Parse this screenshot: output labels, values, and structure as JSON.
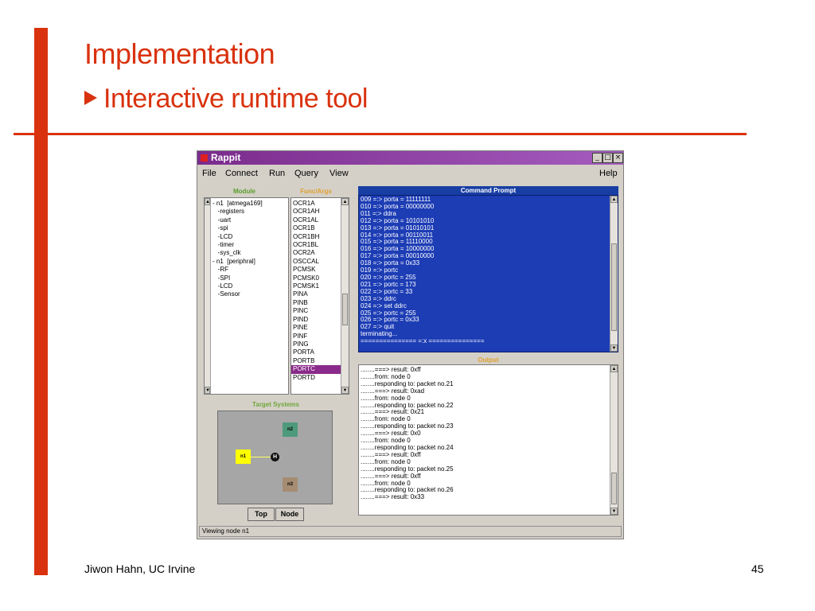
{
  "slide": {
    "title": "Implementation",
    "subtitle": "Interactive runtime tool",
    "footer_author": "Jiwon Hahn, UC Irvine",
    "page_number": "45",
    "accent_color": "#d9320e"
  },
  "app": {
    "title": "Rappit",
    "menu": [
      "File",
      "Connect",
      "Run",
      "Query",
      "View"
    ],
    "help": "Help",
    "module_label": "Module",
    "func_label": "Func/Args",
    "modules": [
      "- n1  [atmega169]",
      "   -registers",
      "   -uart",
      "   -spi",
      "   -LCD",
      "   -timer",
      "   -sys_clk",
      "- n1  [periphral]",
      "   -RF",
      "   -SPI",
      "   -LCD",
      "   -Sensor"
    ],
    "funcs": [
      "OCR1A",
      "OCR1AH",
      "OCR1AL",
      "OCR1B",
      "OCR1BH",
      "OCR1BL",
      "OCR2A",
      "OSCCAL",
      "PCMSK",
      "PCMSK0",
      "PCMSK1",
      "PINA",
      "PINB",
      "PINC",
      "PIND",
      "PINE",
      "PINF",
      "PING",
      "PORTA",
      "PORTB",
      "PORTC",
      "PORTD"
    ],
    "selected_func": "PORTC",
    "command_prompt_label": "Command Prompt",
    "command_lines": [
      "009 =:> porta = 11111111",
      "010 =:> porta = 00000000",
      "011 =:> ddra",
      "012 =:> porta = 10101010",
      "013 =:> porta = 01010101",
      "014 =:> porta = 00110011",
      "015 =:> porta = 11110000",
      "016 =:> porta = 10000000",
      "017 =:> porta = 00010000",
      "018 =:> porta = 0x33",
      "019 =:> portc",
      "020 =:> portc = 255",
      "021 =:> portc = 173",
      "022 =:> portc = 33",
      "023 =:> ddrc",
      "024 =:> set ddrc",
      "025 =:> portc = 255",
      "026 =:> portc = 0x33",
      "027 =:> quit",
      "terminating...",
      "=============== =:x ==============="
    ],
    "output_label": "Output",
    "output_lines": [
      "........===> result: 0xff",
      "........from: node 0",
      "........responding to: packet no.21",
      "........===> result: 0xad",
      "........from: node 0",
      "........responding to: packet no.22",
      "........===> result: 0x21",
      "........from: node 0",
      "........responding to: packet no.23",
      "........===> result: 0x0",
      "........from: node 0",
      "........responding to: packet no.24",
      "........===> result: 0xff",
      "........from: node 0",
      "........responding to: packet no.25",
      "........===> result: 0xff",
      "........from: node 0",
      "........responding to: packet no.26",
      "........===> result: 0x33"
    ],
    "target_label": "Target Systems",
    "nodes": {
      "n1": "n1",
      "n2": "n2",
      "n3": "n3",
      "hub": "H"
    },
    "node_colors": {
      "n1": "#ffff00",
      "n2": "#4e9a7c",
      "n3": "#a58c72"
    },
    "buttons": {
      "top": "Top",
      "node": "Node"
    },
    "status": "Viewing node n1"
  }
}
